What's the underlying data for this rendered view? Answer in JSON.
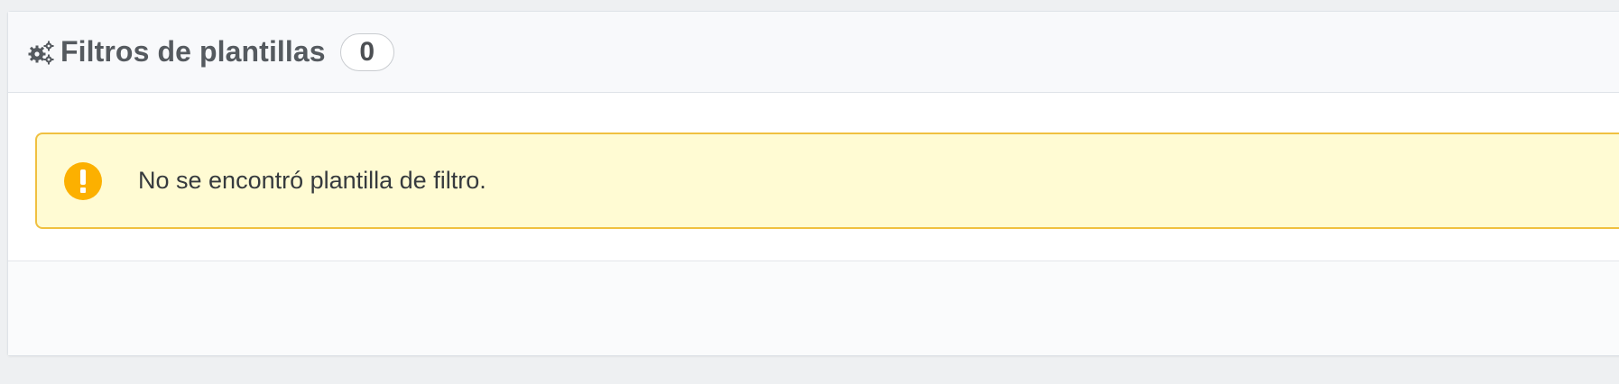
{
  "panel": {
    "title": "Filtros de plantillas",
    "count": "0",
    "icon": "gears-icon"
  },
  "alert": {
    "icon": "warning-icon",
    "message": "No se encontró plantilla de filtro.",
    "colors": {
      "background": "#fffbd3",
      "border": "#f0c040",
      "icon": "#fcb000"
    }
  }
}
